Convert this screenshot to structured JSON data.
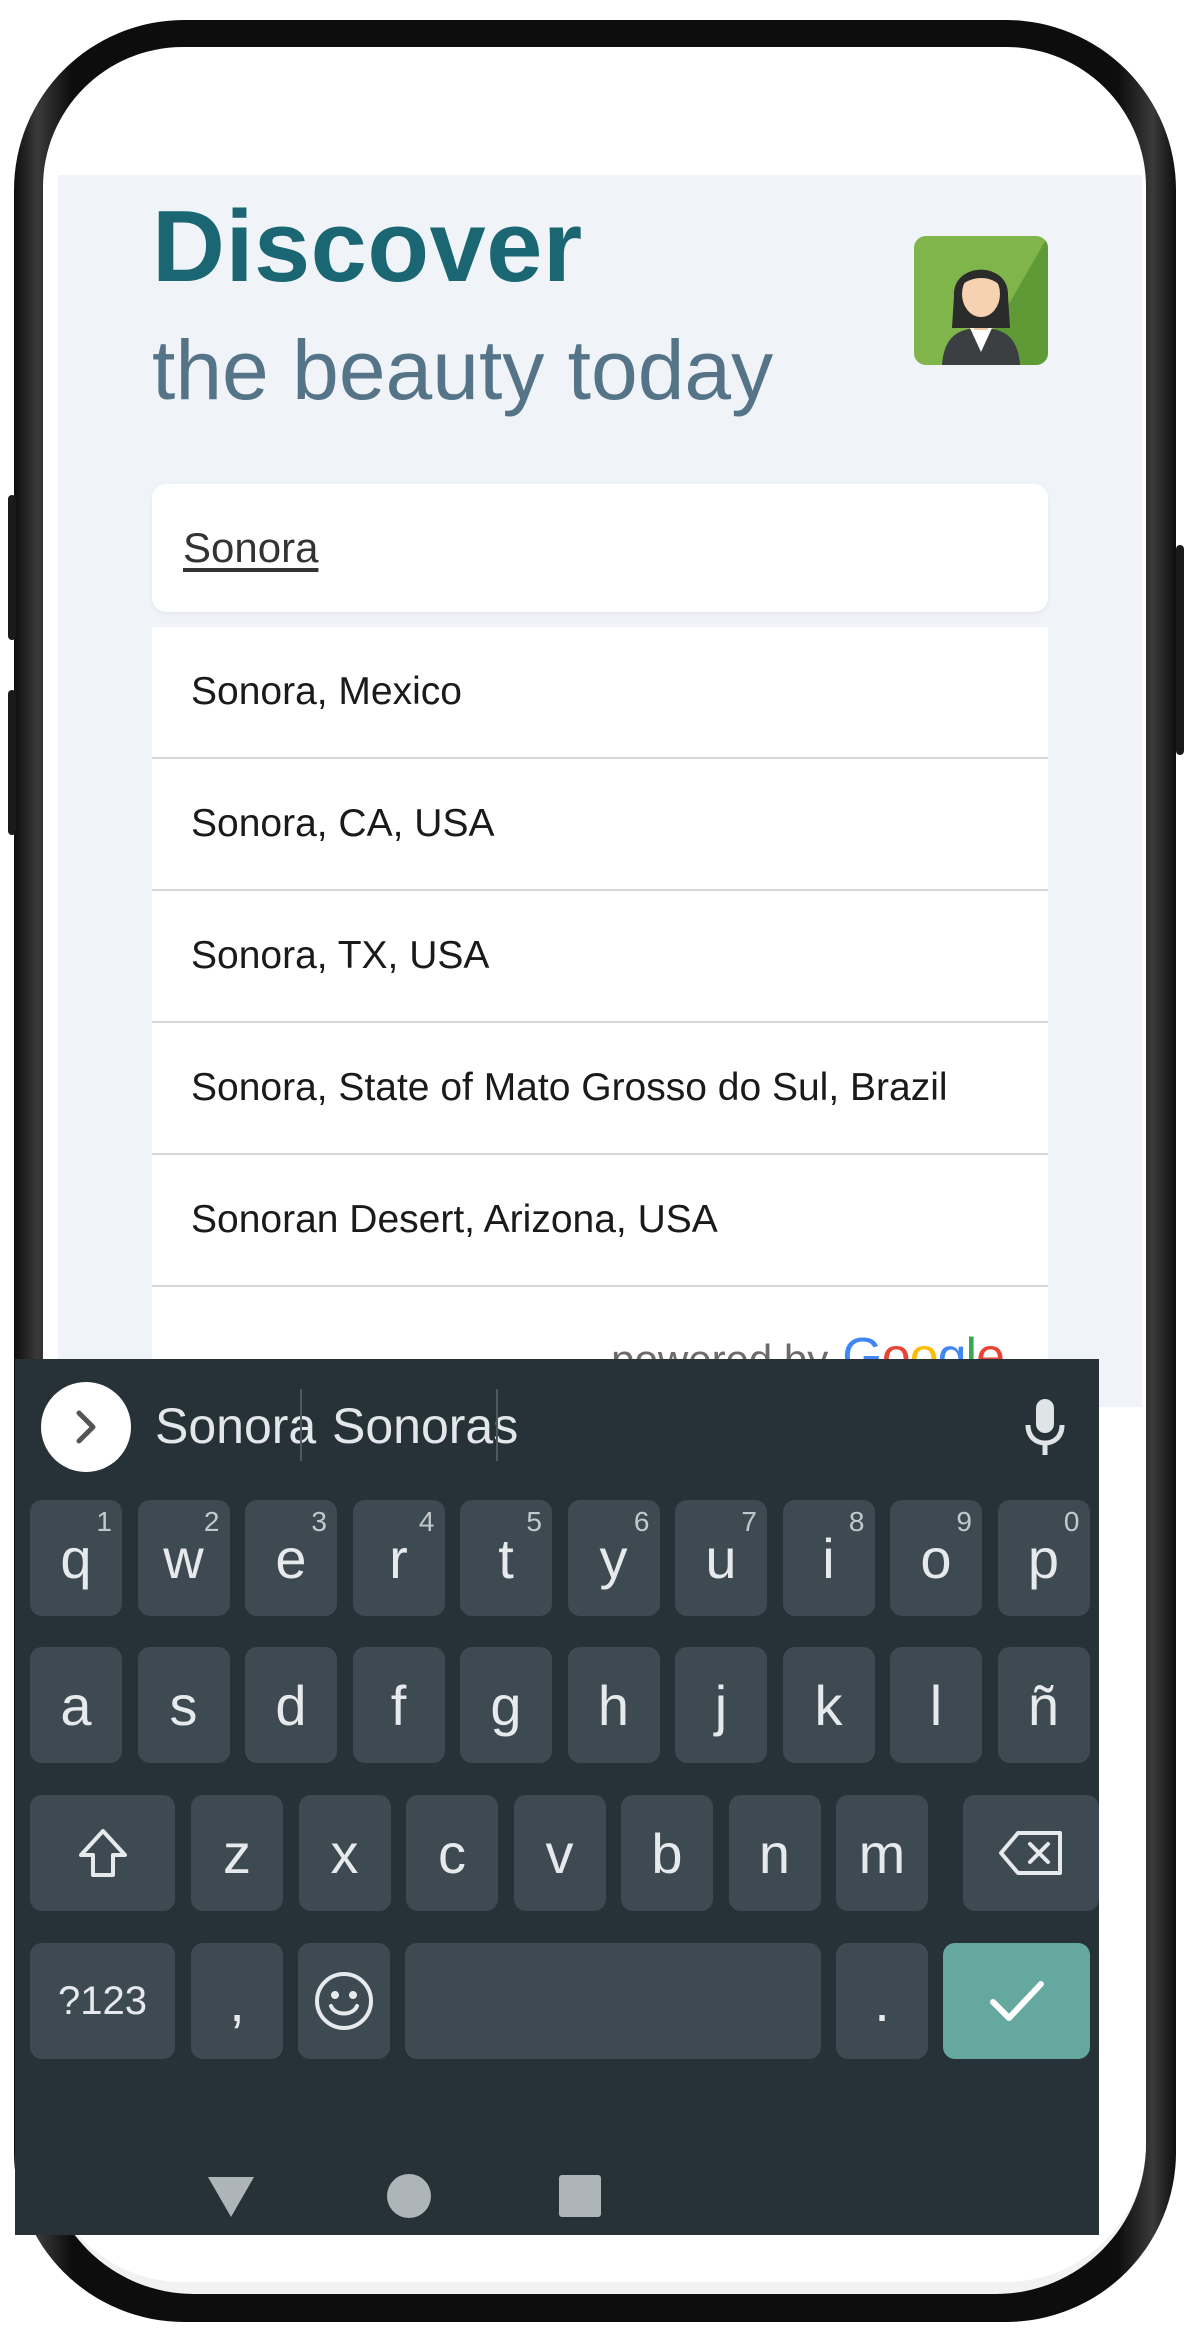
{
  "header": {
    "title": "Discover",
    "subtitle": "the beauty today"
  },
  "search": {
    "value": "Sonora"
  },
  "suggestions": [
    "Sonora, Mexico",
    "Sonora, CA, USA",
    "Sonora, TX, USA",
    "Sonora, State of Mato Grosso do Sul, Brazil",
    "Sonoran Desert, Arizona, USA"
  ],
  "attribution": {
    "prefix": "powered by",
    "brand": "Google",
    "brand_colors": [
      "#4285F4",
      "#EA4335",
      "#FBBC05",
      "#4285F4",
      "#34A853",
      "#EA4335"
    ]
  },
  "keyboard": {
    "suggestions": [
      "Sonora",
      "Sonoras"
    ],
    "row1": [
      {
        "key": "q",
        "hint": "1"
      },
      {
        "key": "w",
        "hint": "2"
      },
      {
        "key": "e",
        "hint": "3"
      },
      {
        "key": "r",
        "hint": "4"
      },
      {
        "key": "t",
        "hint": "5"
      },
      {
        "key": "y",
        "hint": "6"
      },
      {
        "key": "u",
        "hint": "7"
      },
      {
        "key": "i",
        "hint": "8"
      },
      {
        "key": "o",
        "hint": "9"
      },
      {
        "key": "p",
        "hint": "0"
      }
    ],
    "row2": [
      "a",
      "s",
      "d",
      "f",
      "g",
      "h",
      "j",
      "k",
      "l",
      "ñ"
    ],
    "row3": [
      "z",
      "x",
      "c",
      "v",
      "b",
      "n",
      "m"
    ],
    "symbols_label": "?123",
    "comma": ",",
    "period": "."
  },
  "colors": {
    "title": "#1a6672",
    "subtitle": "#557488",
    "keyboard_bg": "#263238",
    "key_bg": "#3e4a51",
    "enter_key": "#64a8a0"
  }
}
